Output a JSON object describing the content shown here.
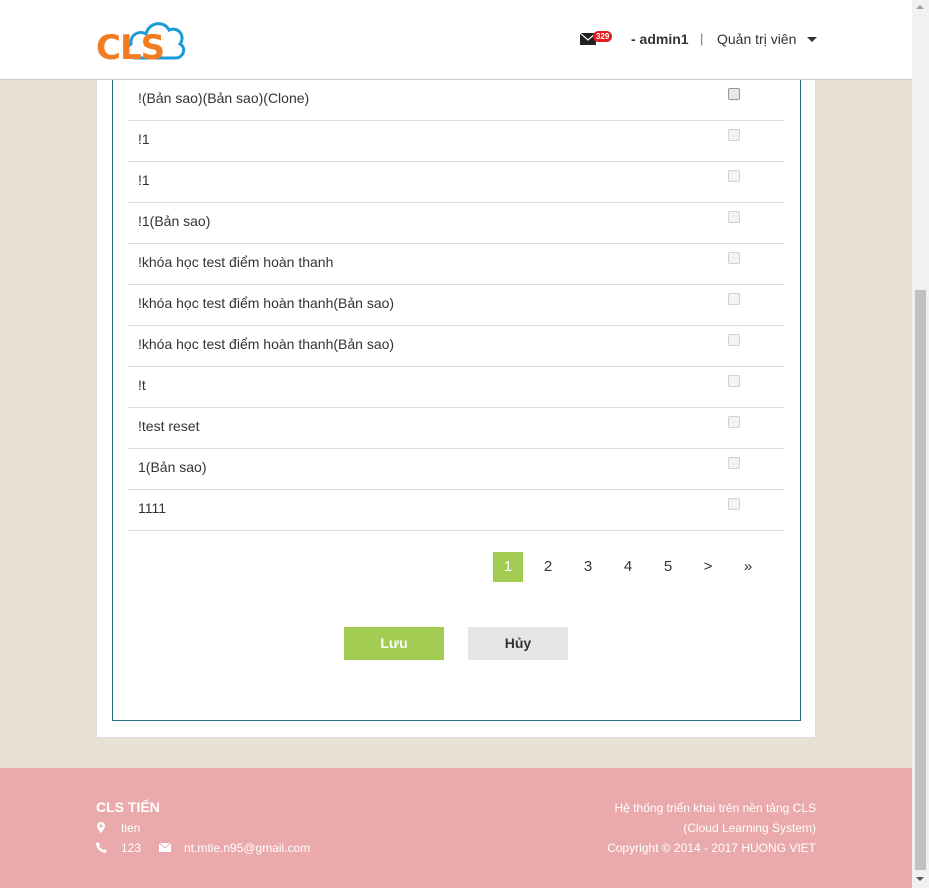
{
  "header": {
    "logo_text": "CLS",
    "mail_count": "329",
    "user": "- admin1",
    "separator": "|",
    "role": "Quản trị viên"
  },
  "courses": [
    {
      "label": "!(Bản sao)(Bản sao)(Clone)",
      "checked": false
    },
    {
      "label": "!1",
      "checked": false
    },
    {
      "label": "!1",
      "checked": false
    },
    {
      "label": "!1(Bản sao)",
      "checked": false
    },
    {
      "label": "!khóa học test điểm hoàn thanh",
      "checked": false
    },
    {
      "label": "!khóa học test điểm hoàn thanh(Bản sao)",
      "checked": false
    },
    {
      "label": "!khóa học test điểm hoàn thanh(Bản sao)",
      "checked": false
    },
    {
      "label": "!t",
      "checked": false
    },
    {
      "label": "!test reset",
      "checked": false
    },
    {
      "label": "1(Bản sao)",
      "checked": false
    },
    {
      "label": "1111",
      "checked": false
    }
  ],
  "pagination": {
    "pages": [
      "1",
      "2",
      "3",
      "4",
      "5"
    ],
    "active": "1",
    "next": ">",
    "last": "»"
  },
  "actions": {
    "save": "Lưu",
    "cancel": "Hủy"
  },
  "footer": {
    "title": "CLS TIẾN",
    "address": "tien",
    "phone": "123",
    "email": "nt.mtie.n95@gmail.com",
    "right_line1": "Hệ thống triển khai trên nền tảng CLS",
    "right_line2": "(Cloud Learning System)",
    "right_line3": "Copyright © 2014 - 2017 HUONG VIET"
  },
  "colors": {
    "accent_green": "#a3cc53",
    "logo_orange": "#f47c20",
    "logo_blue": "#1a9ad6",
    "footer_pink": "#eaa9aa",
    "badge_red": "#e21b1b",
    "panel_border": "#2a6b86"
  }
}
